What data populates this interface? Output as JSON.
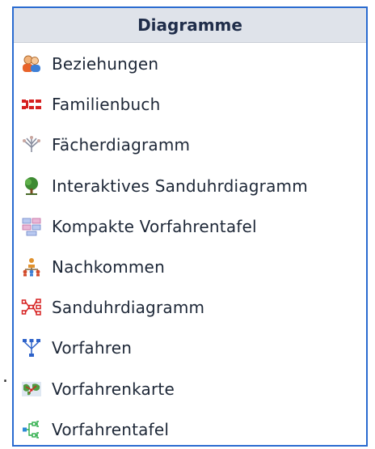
{
  "left_margin_char": ".",
  "menu": {
    "title": "Diagramme",
    "items": [
      {
        "label": "Beziehungen",
        "icon": "people-icon"
      },
      {
        "label": "Familienbuch",
        "icon": "family-book-icon"
      },
      {
        "label": "Fächerdiagramm",
        "icon": "fan-chart-icon"
      },
      {
        "label": "Interaktives Sanduhrdiagramm",
        "icon": "tree-icon"
      },
      {
        "label": "Kompakte Vorfahrentafel",
        "icon": "compact-chart-icon"
      },
      {
        "label": "Nachkommen",
        "icon": "descendants-icon"
      },
      {
        "label": "Sanduhrdiagramm",
        "icon": "hourglass-chart-icon"
      },
      {
        "label": "Vorfahren",
        "icon": "ancestors-icon"
      },
      {
        "label": "Vorfahrenkarte",
        "icon": "ancestor-map-icon"
      },
      {
        "label": "Vorfahrentafel",
        "icon": "pedigree-chart-icon"
      }
    ]
  }
}
